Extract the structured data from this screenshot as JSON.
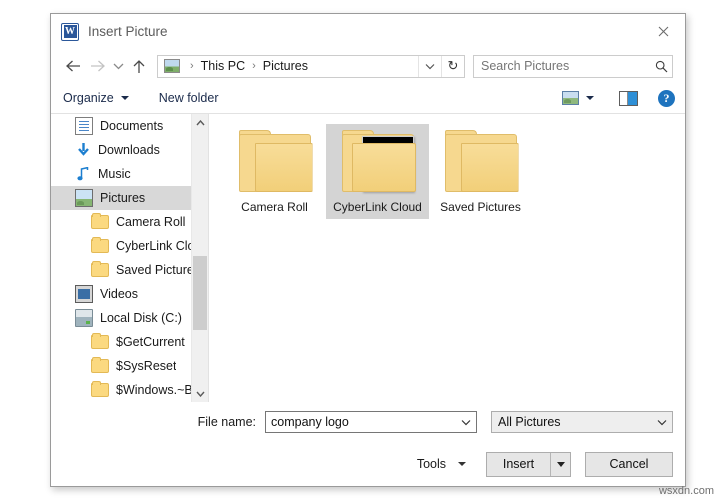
{
  "window": {
    "title": "Insert Picture",
    "app_icon": "word-icon",
    "app_icon_letter": "W",
    "close_label": "✕"
  },
  "address_bar": {
    "back_icon": "back-arrow-icon",
    "forward_icon": "forward-arrow-icon",
    "recent_icon": "chevron-down-icon",
    "up_icon": "up-arrow-icon",
    "location_icon": "pictures-library-icon",
    "breadcrumbs": [
      "This PC",
      "Pictures"
    ],
    "separator": "›",
    "dropdown_icon": "chevron-down-icon",
    "refresh_icon": "refresh-icon",
    "refresh_glyph": "↻"
  },
  "search": {
    "placeholder": "Search Pictures",
    "icon": "search-icon"
  },
  "toolbar": {
    "organize_label": "Organize",
    "new_folder_label": "New folder",
    "view_icon": "view-options-icon",
    "view_caret_icon": "chevron-down-icon",
    "preview_pane_icon": "preview-pane-icon",
    "help_icon": "help-icon",
    "help_glyph": "?"
  },
  "sidebar": {
    "scroll_up_icon": "chevron-up-icon",
    "scroll_down_icon": "chevron-down-icon",
    "items": [
      {
        "label": "Documents",
        "icon": "documents-icon",
        "level": 0,
        "selected": false
      },
      {
        "label": "Downloads",
        "icon": "downloads-icon",
        "level": 0,
        "selected": false
      },
      {
        "label": "Music",
        "icon": "music-icon",
        "level": 0,
        "selected": false
      },
      {
        "label": "Pictures",
        "icon": "pictures-icon",
        "level": 0,
        "selected": true
      },
      {
        "label": "Camera Roll",
        "icon": "folder-icon",
        "level": 1,
        "selected": false
      },
      {
        "label": "CyberLink Clou",
        "icon": "folder-icon",
        "level": 1,
        "selected": false
      },
      {
        "label": "Saved Pictures",
        "icon": "folder-icon",
        "level": 1,
        "selected": false
      },
      {
        "label": "Videos",
        "icon": "videos-icon",
        "level": 0,
        "selected": false
      },
      {
        "label": "Local Disk (C:)",
        "icon": "disk-icon",
        "level": 0,
        "selected": false
      },
      {
        "label": "$GetCurrent",
        "icon": "folder-icon",
        "level": 1,
        "selected": false
      },
      {
        "label": "$SysReset",
        "icon": "folder-icon",
        "level": 1,
        "selected": false
      },
      {
        "label": "$Windows.~BT",
        "icon": "folder-icon",
        "level": 1,
        "selected": false
      }
    ]
  },
  "files": {
    "items": [
      {
        "label": "Camera Roll",
        "type": "folder",
        "selected": false,
        "thumbnail": "none"
      },
      {
        "label": "CyberLink Cloud",
        "type": "folder",
        "selected": true,
        "thumbnail": "vlc-video-thumbnail"
      },
      {
        "label": "Saved Pictures",
        "type": "folder",
        "selected": false,
        "thumbnail": "none"
      }
    ]
  },
  "footer": {
    "filename_label": "File name:",
    "filename_value": "company logo",
    "filename_dropdown_icon": "chevron-down-icon",
    "filter_value": "All Pictures",
    "filter_dropdown_icon": "chevron-down-icon",
    "tools_label": "Tools",
    "tools_caret_icon": "chevron-down-icon",
    "insert_label": "Insert",
    "insert_split_icon": "chevron-down-icon",
    "cancel_label": "Cancel"
  },
  "watermark": {
    "text": "wsxdn.com"
  }
}
